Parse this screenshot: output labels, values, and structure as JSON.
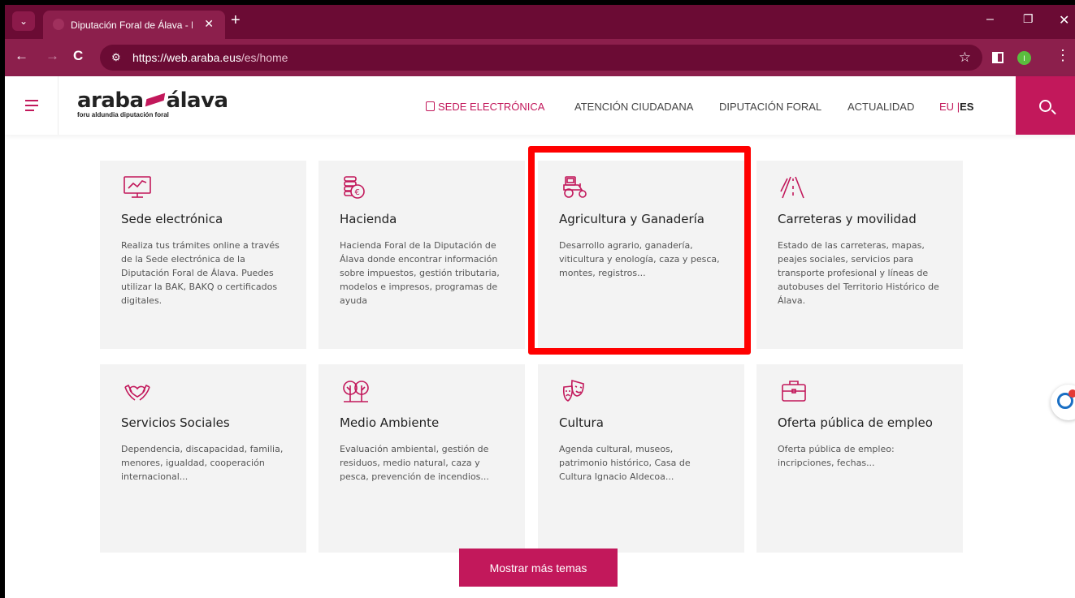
{
  "browser": {
    "tab_title": "Diputación Foral de Álava - En l",
    "url_host": "https://web.araba.eus",
    "url_path": "/es/home",
    "profile_initial": "I"
  },
  "site": {
    "logo_main_left": "araba",
    "logo_main_right": "álava",
    "logo_sub": "foru aldundia  diputación foral",
    "nav": {
      "sede": "SEDE ELECTRÓNICA",
      "atencion": "ATENCIÓN CIUDADANA",
      "diputacion": "DIPUTACIÓN FORAL",
      "actualidad": "ACTUALIDAD"
    },
    "lang": {
      "eu": "EU",
      "sep": "|",
      "es": "ES"
    }
  },
  "cards": [
    {
      "title": "Sede electrónica",
      "desc": "Realiza tus trámites online a través de la Sede electrónica de la Diputación Foral de Álava. Puedes utilizar la BAK, BAKQ o certificados digitales.",
      "icon": "monitor-chart-icon"
    },
    {
      "title": "Hacienda",
      "desc": "Hacienda Foral de la Diputación de Álava donde encontrar información sobre impuestos, gestión tributaria, modelos e impresos, programas de ayuda",
      "icon": "coins-euro-icon"
    },
    {
      "title": "Agricultura y Ganadería",
      "desc": "Desarrollo agrario, ganadería, viticultura y enología, caza y pesca, montes, registros...",
      "icon": "tractor-icon"
    },
    {
      "title": "Carreteras y movilidad",
      "desc": "Estado de las carreteras, mapas, peajes sociales, servicios para transporte profesional y líneas de autobuses del Territorio Histórico de Álava.",
      "icon": "road-icon"
    },
    {
      "title": "Servicios Sociales",
      "desc": "Dependencia, discapacidad, familia, menores, igualdad, cooperación internacional...",
      "icon": "hands-heart-icon"
    },
    {
      "title": "Medio Ambiente",
      "desc": "Evaluación ambiental, gestión de residuos, medio natural, caza y pesca, prevención de incendios...",
      "icon": "trees-icon"
    },
    {
      "title": "Cultura",
      "desc": "Agenda cultural, museos, patrimonio histórico, Casa de Cultura Ignacio Aldecoa...",
      "icon": "theater-masks-icon"
    },
    {
      "title": "Oferta pública de empleo",
      "desc": "Oferta pública de empleo: incripciones, fechas...",
      "icon": "briefcase-icon"
    }
  ],
  "more_button": "Mostrar más temas",
  "colors": {
    "brand": "#c2185b",
    "chrome": "#6b0b34",
    "highlight": "#ff0000"
  }
}
